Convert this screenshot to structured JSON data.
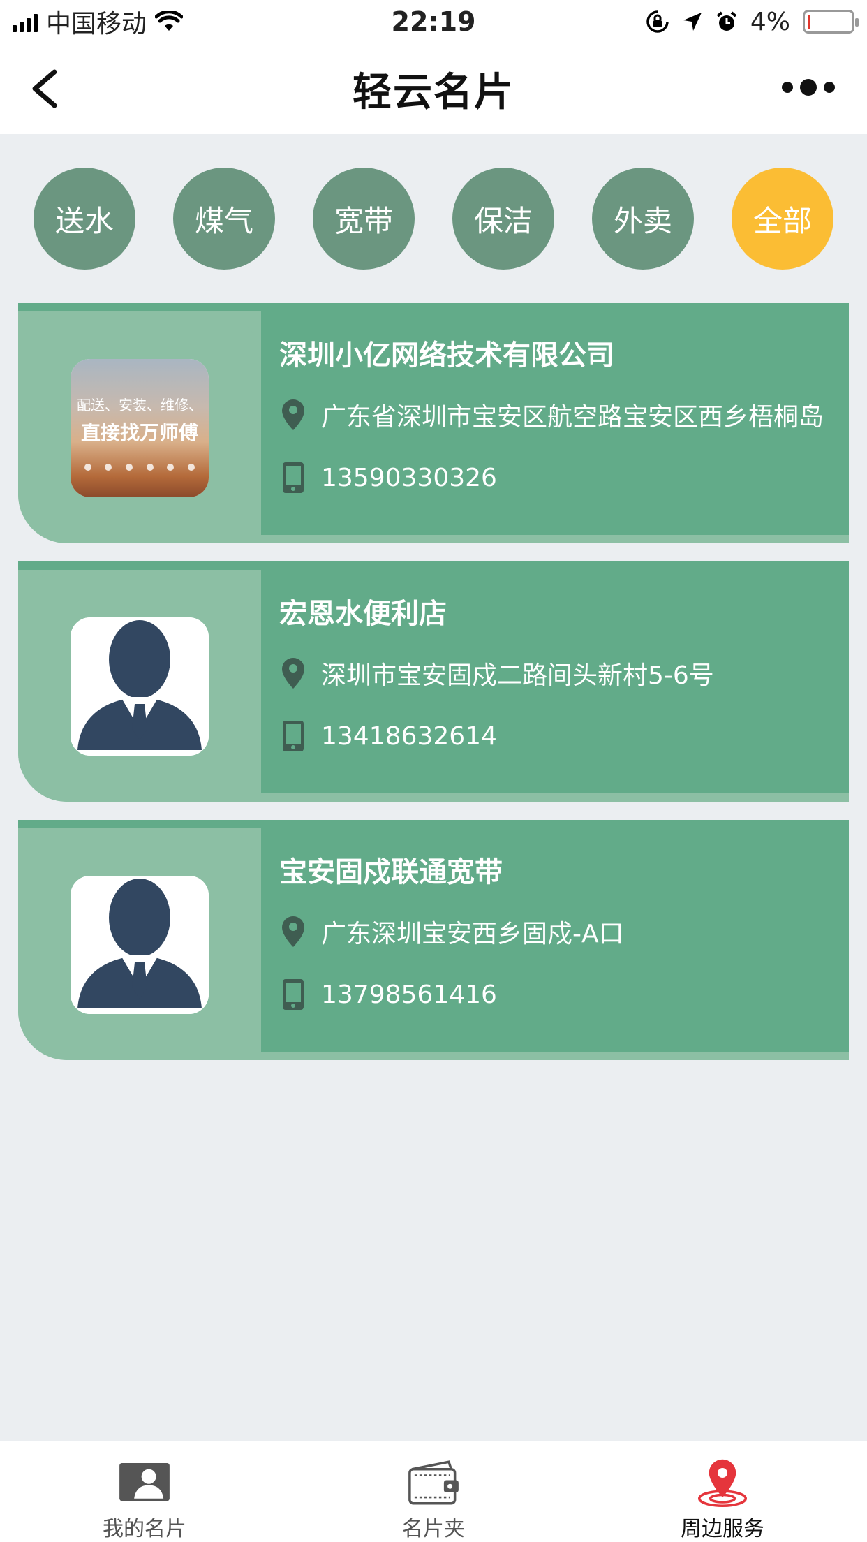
{
  "status_bar": {
    "carrier": "中国移动",
    "time": "22:19",
    "battery": "4%"
  },
  "nav": {
    "title": "轻云名片"
  },
  "categories": [
    {
      "label": "送水",
      "active": false
    },
    {
      "label": "煤气",
      "active": false
    },
    {
      "label": "宽带",
      "active": false
    },
    {
      "label": "保洁",
      "active": false
    },
    {
      "label": "外卖",
      "active": false
    },
    {
      "label": "全部",
      "active": true
    }
  ],
  "cards": [
    {
      "name": "深圳小亿网络技术有限公司",
      "address": "广东省深圳市宝安区航空路宝安区西乡梧桐岛",
      "phone": "13590330326",
      "avatar": "promo-image",
      "avatar_text_1": "配送、安装、维修、",
      "avatar_text_2": "直接找万师傅"
    },
    {
      "name": "宏恩水便利店",
      "address": "深圳市宝安固戍二路间头新村5-6号",
      "phone": "13418632614",
      "avatar": "default-person-avatar"
    },
    {
      "name": "宝安固戍联通宽带",
      "address": "广东深圳宝安西乡固戍-A口",
      "phone": "13798561416",
      "avatar": "default-person-avatar"
    }
  ],
  "tabs": [
    {
      "label": "我的名片",
      "icon": "id-card-icon",
      "active": false
    },
    {
      "label": "名片夹",
      "icon": "wallet-icon",
      "active": false
    },
    {
      "label": "周边服务",
      "icon": "location-pin-icon",
      "active": true
    }
  ],
  "colors": {
    "chip": "#6b9680",
    "chip_active": "#fbbd34",
    "card_dark": "#62ab89",
    "card_light": "#8cbfa4",
    "background": "#ebeef1",
    "pin_active": "#e5353c"
  }
}
